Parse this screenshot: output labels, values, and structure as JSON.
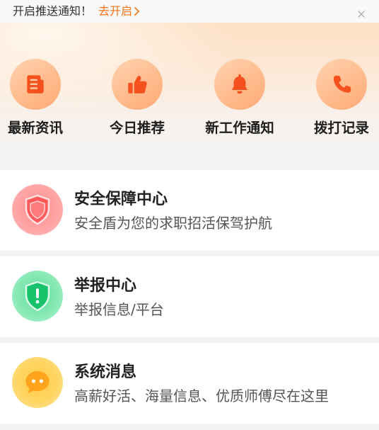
{
  "notice": {
    "text": "开启推送通知！",
    "action": "去开启",
    "action_icon": "chevron-right-icon",
    "close_icon": "close-icon"
  },
  "quick_actions": [
    {
      "label": "最新资讯",
      "icon": "newspaper-icon"
    },
    {
      "label": "今日推荐",
      "icon": "thumbs-up-icon"
    },
    {
      "label": "新工作通知",
      "icon": "bell-icon"
    },
    {
      "label": "拨打记录",
      "icon": "phone-icon"
    }
  ],
  "cards": [
    {
      "title": "安全保障中心",
      "subtitle": "安全盾为您的求职招活保驾护航",
      "icon": "safety-shield-icon"
    },
    {
      "title": "举报中心",
      "subtitle": "举报信息/平台",
      "icon": "report-shield-icon"
    },
    {
      "title": "系统消息",
      "subtitle": "高薪好活、海量信息、优质师傅尽在这里",
      "icon": "chat-bubble-icon"
    }
  ],
  "colors": {
    "accent": "#f5761a",
    "quick_action_icon": "#f4511e",
    "safety_red": "#ff5a5a",
    "report_green": "#17c26a",
    "message_orange": "#ffa41b",
    "page_background": "#f2f2f2"
  }
}
